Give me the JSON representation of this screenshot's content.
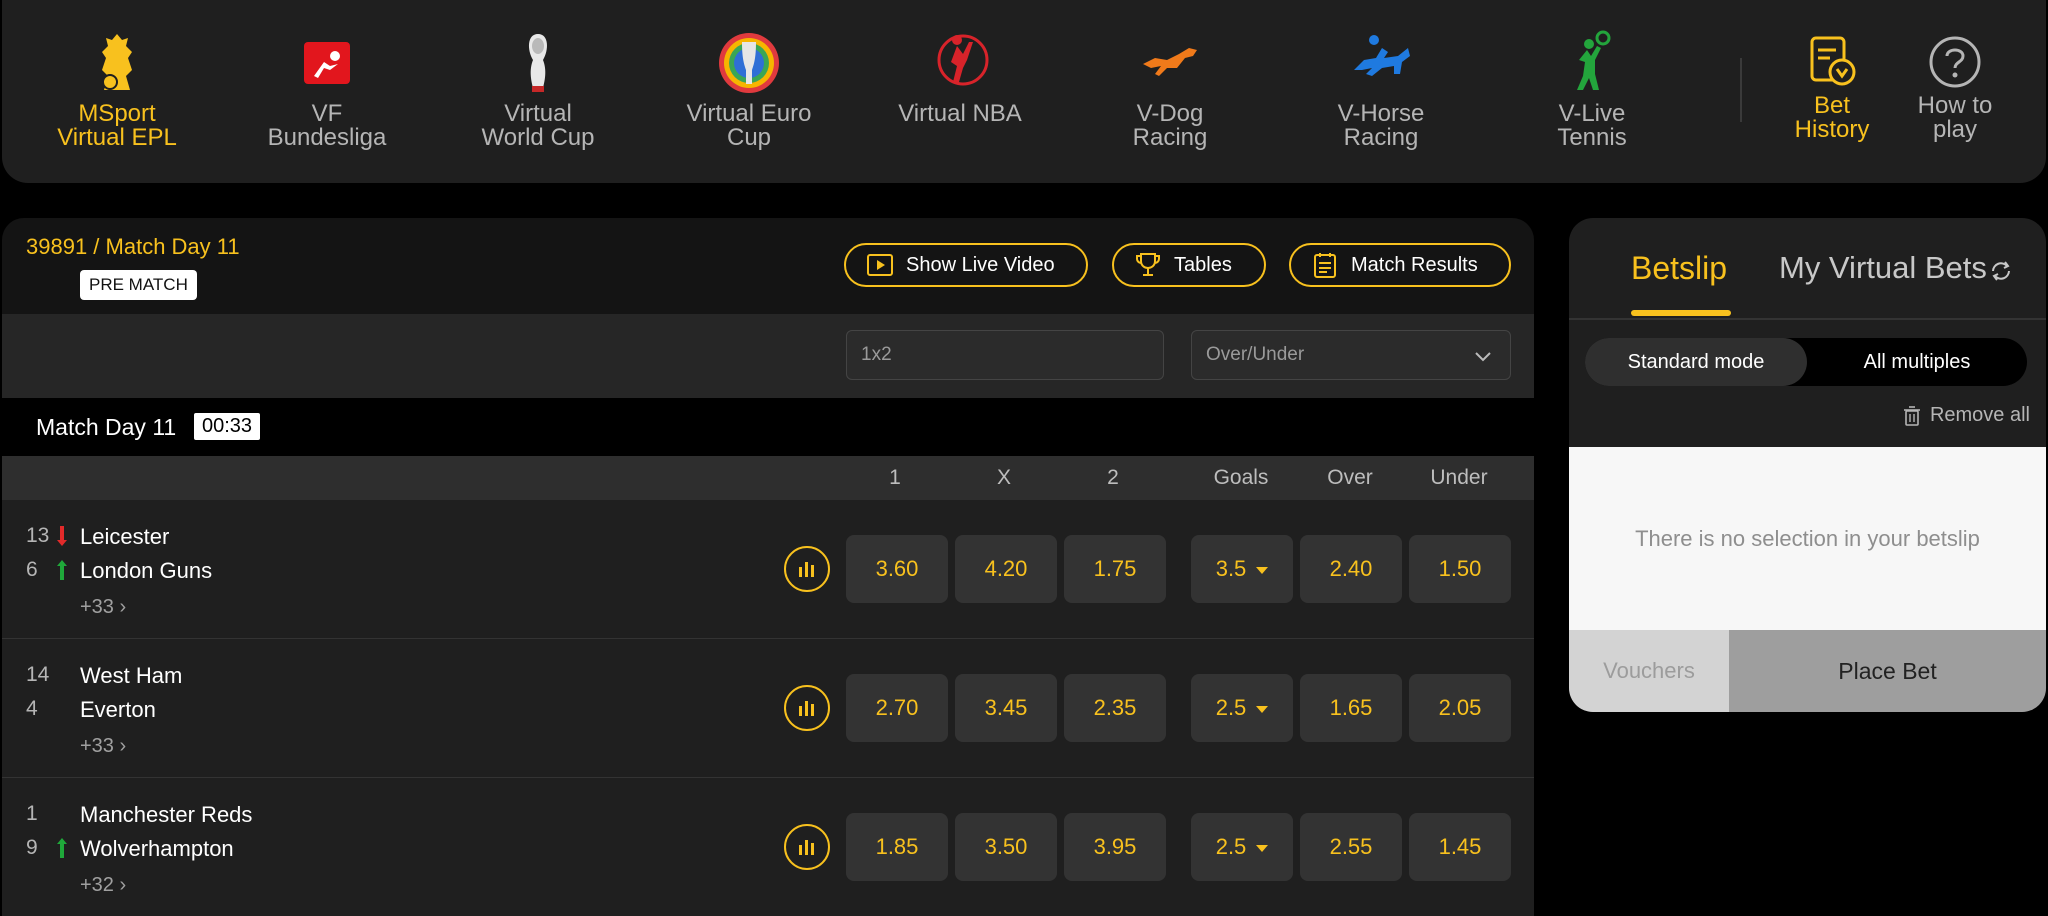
{
  "nav": {
    "items": [
      {
        "label_l1": "MSport",
        "label_l2": "Virtual EPL",
        "icon": "lion-crest-icon",
        "active": true
      },
      {
        "label_l1": "VF",
        "label_l2": "Bundesliga",
        "icon": "bundesliga-icon"
      },
      {
        "label_l1": "Virtual",
        "label_l2": "World Cup",
        "icon": "world-cup-trophy-icon"
      },
      {
        "label_l1": "Virtual Euro",
        "label_l2": "Cup",
        "icon": "euro-cup-trophy-icon"
      },
      {
        "label_l1": "Virtual NBA",
        "label_l2": "",
        "icon": "basketball-player-icon"
      },
      {
        "label_l1": "V-Dog",
        "label_l2": "Racing",
        "icon": "greyhound-icon"
      },
      {
        "label_l1": "V-Horse",
        "label_l2": "Racing",
        "icon": "horse-racing-icon"
      },
      {
        "label_l1": "V-Live",
        "label_l2": "Tennis",
        "icon": "tennis-player-icon"
      }
    ],
    "bet_history": {
      "label_l1": "Bet",
      "label_l2": "History",
      "icon": "bet-history-icon"
    },
    "how_to_play": {
      "label_l1": "How to",
      "label_l2": "play",
      "icon": "help-icon"
    }
  },
  "match_header": {
    "event": "39891 / Match Day 11",
    "status": "PRE MATCH",
    "buttons": {
      "live_video": "Show Live Video",
      "tables": "Tables",
      "results": "Match Results"
    }
  },
  "filters": {
    "market1": "1x2",
    "market2": "Over/Under"
  },
  "matchday": {
    "title": "Match Day 11",
    "timer": "00:33"
  },
  "columns": {
    "c1": "1",
    "cx": "X",
    "c2": "2",
    "goals": "Goals",
    "over": "Over",
    "under": "Under"
  },
  "matches": [
    {
      "home_rank": "13",
      "home_trend": "down",
      "home": "Leicester",
      "away_rank": "6",
      "away_trend": "up",
      "away": "London Guns",
      "more": "+33",
      "odds_1": "3.60",
      "odds_x": "4.20",
      "odds_2": "1.75",
      "goals": "3.5",
      "over": "2.40",
      "under": "1.50"
    },
    {
      "home_rank": "14",
      "home_trend": "",
      "home": "West Ham",
      "away_rank": "4",
      "away_trend": "",
      "away": "Everton",
      "more": "+33",
      "odds_1": "2.70",
      "odds_x": "3.45",
      "odds_2": "2.35",
      "goals": "2.5",
      "over": "1.65",
      "under": "2.05"
    },
    {
      "home_rank": "1",
      "home_trend": "",
      "home": "Manchester Reds",
      "away_rank": "9",
      "away_trend": "up",
      "away": "Wolverhampton",
      "more": "+32",
      "odds_1": "1.85",
      "odds_x": "3.50",
      "odds_2": "3.95",
      "goals": "2.5",
      "over": "2.55",
      "under": "1.45"
    }
  ],
  "betslip": {
    "tab_active": "Betslip",
    "tab_other": "My Virtual Bets",
    "mode_standard": "Standard mode",
    "mode_multiples": "All multiples",
    "remove_all": "Remove all",
    "empty": "There is no selection in your betslip",
    "vouchers": "Vouchers",
    "place_bet": "Place Bet"
  },
  "colors": {
    "accent": "#f8c11e",
    "trend_up": "#1fa83a",
    "trend_down": "#e22a2a"
  }
}
